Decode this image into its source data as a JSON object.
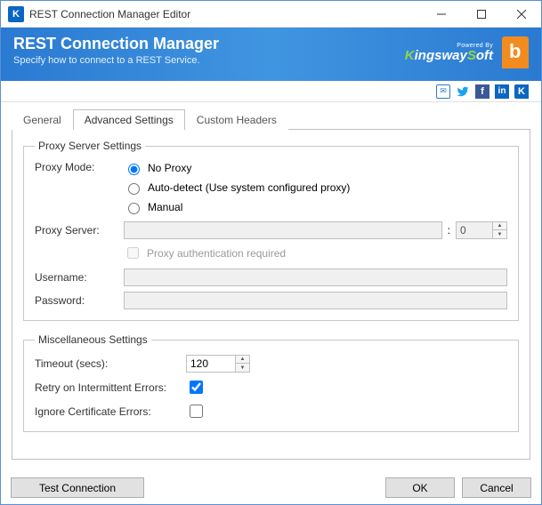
{
  "window": {
    "title": "REST Connection Manager Editor"
  },
  "header": {
    "title": "REST Connection Manager",
    "subtitle": "Specify how to connect to a REST Service.",
    "powered_by": "Powered By",
    "brand": "KingswaySoft"
  },
  "social": {
    "mail": "mail-icon",
    "twitter": "twitter-icon",
    "facebook": "facebook-icon",
    "linkedin": "linkedin-icon",
    "k": "kingsway-icon"
  },
  "tabs": {
    "general": "General",
    "advanced": "Advanced Settings",
    "custom": "Custom Headers",
    "active": "advanced"
  },
  "proxy": {
    "legend": "Proxy Server Settings",
    "mode_label": "Proxy Mode:",
    "options": {
      "none": "No Proxy",
      "auto": "Auto-detect (Use system configured proxy)",
      "manual": "Manual"
    },
    "selected": "none",
    "server_label": "Proxy Server:",
    "server_value": "",
    "port_value": "0",
    "auth_required_label": "Proxy authentication required",
    "auth_required": false,
    "username_label": "Username:",
    "username_value": "",
    "password_label": "Password:",
    "password_value": ""
  },
  "misc": {
    "legend": "Miscellaneous Settings",
    "timeout_label": "Timeout (secs):",
    "timeout_value": "120",
    "retry_label": "Retry on Intermittent Errors:",
    "retry_checked": true,
    "ignore_cert_label": "Ignore Certificate Errors:",
    "ignore_cert_checked": false
  },
  "footer": {
    "test": "Test Connection",
    "ok": "OK",
    "cancel": "Cancel"
  }
}
